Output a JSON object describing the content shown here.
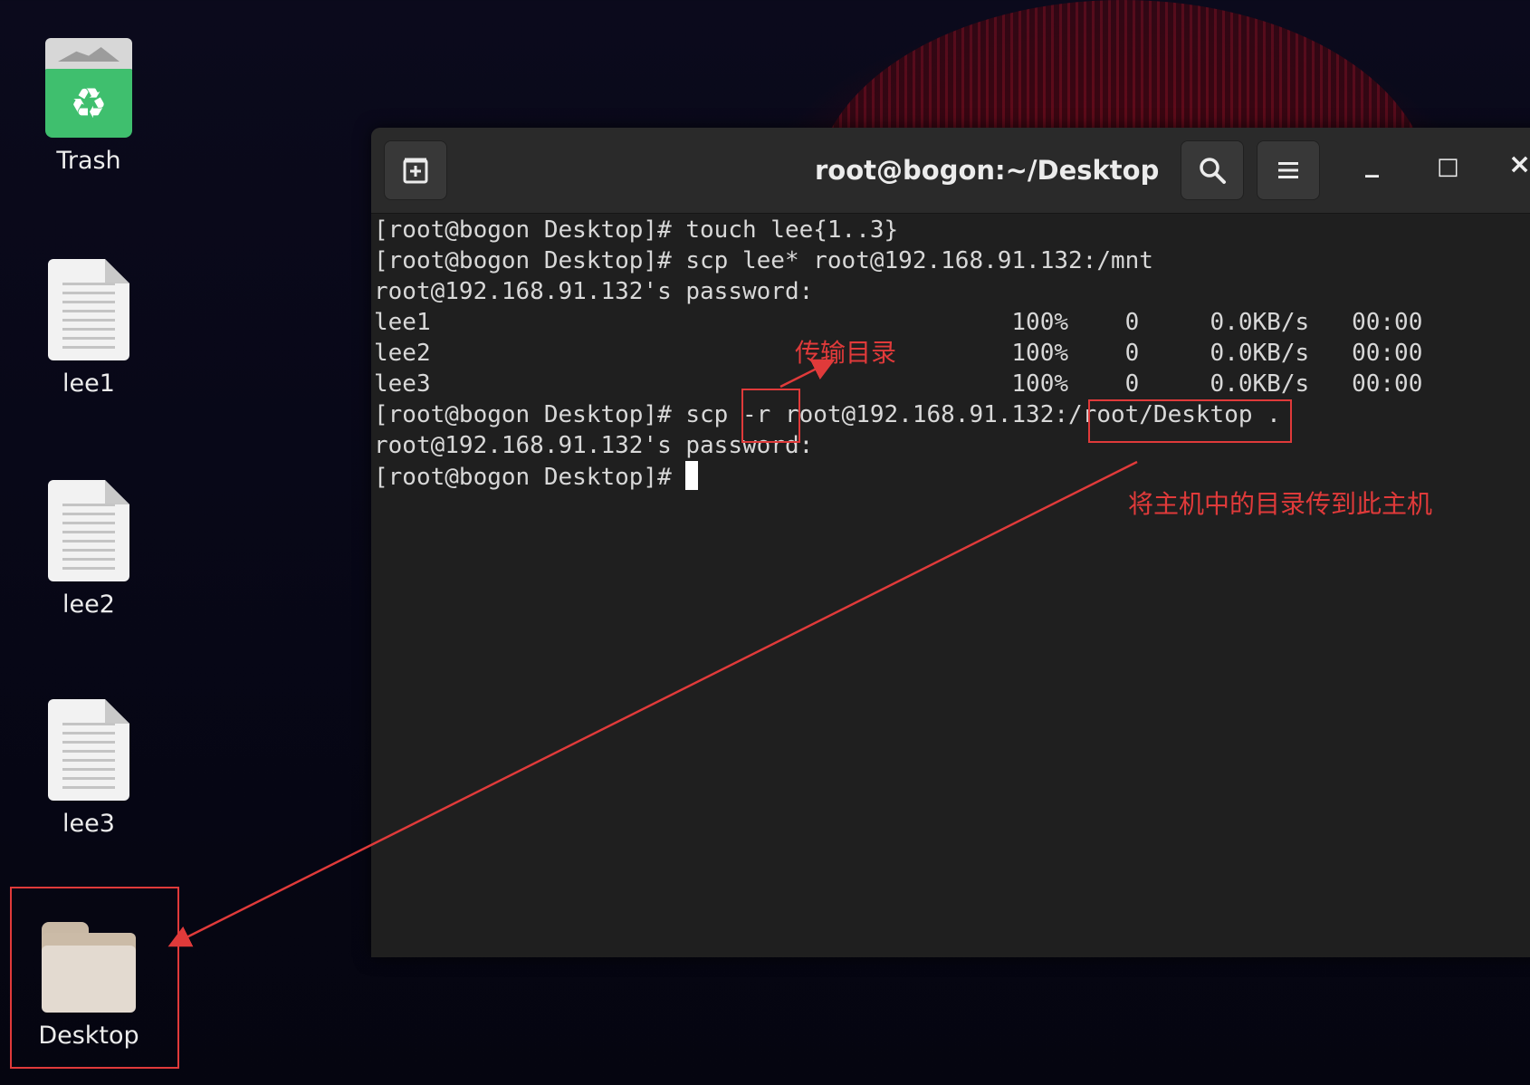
{
  "desktop": {
    "icons": [
      {
        "label": "Trash",
        "icon": "trash-icon"
      },
      {
        "label": "lee1",
        "icon": "text-file-icon"
      },
      {
        "label": "lee2",
        "icon": "text-file-icon"
      },
      {
        "label": "lee3",
        "icon": "text-file-icon"
      },
      {
        "label": "Desktop",
        "icon": "folder-icon"
      }
    ]
  },
  "window": {
    "title": "root@bogon:~/Desktop",
    "new_tab_icon": "new-tab-icon",
    "search_icon": "search-icon",
    "menu_icon": "hamburger-menu-icon",
    "minimize_label": "_",
    "maximize_label": "□",
    "close_label": "×"
  },
  "terminal": {
    "lines": [
      "[root@bogon Desktop]# touch lee{1..3}",
      "[root@bogon Desktop]# scp lee* root@192.168.91.132:/mnt",
      "root@192.168.91.132's password:",
      "lee1                                         100%    0     0.0KB/s   00:00",
      "lee2                                         100%    0     0.0KB/s   00:00",
      "lee3                                         100%    0     0.0KB/s   00:00",
      "[root@bogon Desktop]# scp -r root@192.168.91.132:/root/Desktop .",
      "root@192.168.91.132's password:",
      "[root@bogon Desktop]# "
    ]
  },
  "annotations": {
    "transfer_dir": "传输目录",
    "copy_to_host": "将主机中的目录传到此主机",
    "color": "#e03a3a"
  }
}
